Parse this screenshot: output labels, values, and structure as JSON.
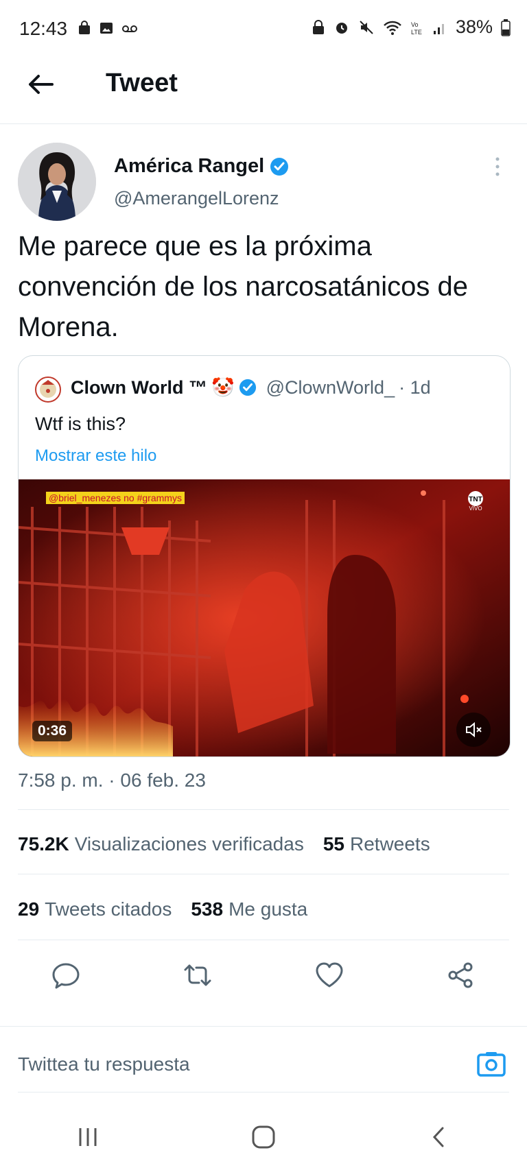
{
  "status_bar": {
    "time": "12:43",
    "battery": "38%",
    "left_icons": [
      "shopping-bag-icon",
      "gallery-icon",
      "voicemail-icon"
    ],
    "right_icons": [
      "lock-icon",
      "alarm-icon",
      "mute-icon",
      "wifi-icon",
      "volte-icon",
      "signal-icon",
      "battery-icon"
    ]
  },
  "header": {
    "title": "Tweet"
  },
  "tweet": {
    "author_name": "América Rangel",
    "author_handle": "@AmerangelLorenz",
    "text": "Me parece que es la próxima convención de los narcosatánicos de Morena.",
    "timestamp": "7:58 p. m. · 06 feb. 23",
    "stats": {
      "views_count": "75.2K",
      "views_label": "Visualizaciones verificadas",
      "retweets_count": "55",
      "retweets_label": "Retweets",
      "quotes_count": "29",
      "quotes_label": "Tweets citados",
      "likes_count": "538",
      "likes_label": "Me gusta"
    }
  },
  "quoted_tweet": {
    "name": "Clown World ™",
    "emoji": "🤡",
    "handle": "@ClownWorld_",
    "age": "· 1d",
    "text": "Wtf is this?",
    "thread_link": "Mostrar este hilo",
    "media": {
      "caption": "@briel_menezes no #grammys",
      "channel": "TNT",
      "channel_sub": "VIVO",
      "duration": "0:36"
    }
  },
  "reply": {
    "placeholder": "Twittea tu respuesta"
  },
  "colors": {
    "accent": "#1d9bf0",
    "text": "#0f1419",
    "secondary": "#536471",
    "divider": "#e6ecf0"
  }
}
